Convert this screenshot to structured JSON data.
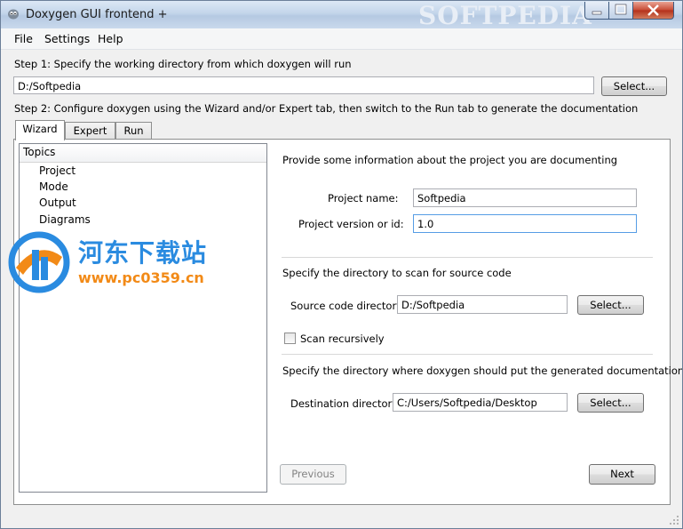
{
  "window": {
    "title": "Doxygen GUI frontend +",
    "watermark": "SOFTPEDIA"
  },
  "menu": [
    "File",
    "Settings",
    "Help"
  ],
  "step1": {
    "label": "Step 1: Specify the working directory from which doxygen will run",
    "value": "D:/Softpedia",
    "select_label": "Select..."
  },
  "step2": {
    "label": "Step 2: Configure doxygen using the Wizard and/or Expert tab, then switch to the Run tab to generate the documentation"
  },
  "tabs": [
    "Wizard",
    "Expert",
    "Run"
  ],
  "topics": {
    "header": "Topics",
    "items": [
      "Project",
      "Mode",
      "Output",
      "Diagrams"
    ]
  },
  "project": {
    "intro": "Provide some information about the project you are documenting",
    "name_label": "Project name:",
    "name_value": "Softpedia",
    "version_label": "Project version or id:",
    "version_value": "1.0"
  },
  "source": {
    "intro": "Specify the directory to scan for source code",
    "dir_label": "Source code directory:",
    "dir_value": "D:/Softpedia",
    "select_label": "Select...",
    "recursive_label": "Scan recursively",
    "recursive_checked": false
  },
  "destination": {
    "intro": "Specify the directory where doxygen should put the generated documentation",
    "dir_label": "Destination directory:",
    "dir_value": "C:/Users/Softpedia/Desktop",
    "select_label": "Select..."
  },
  "nav": {
    "previous": "Previous",
    "next": "Next"
  },
  "overlay": {
    "site_name": "河东下载站",
    "site_url": "www.pc0359.cn"
  },
  "colors": {
    "accent": "#569de5",
    "logo_blue": "#2a8be0",
    "logo_orange": "#f28a17"
  }
}
